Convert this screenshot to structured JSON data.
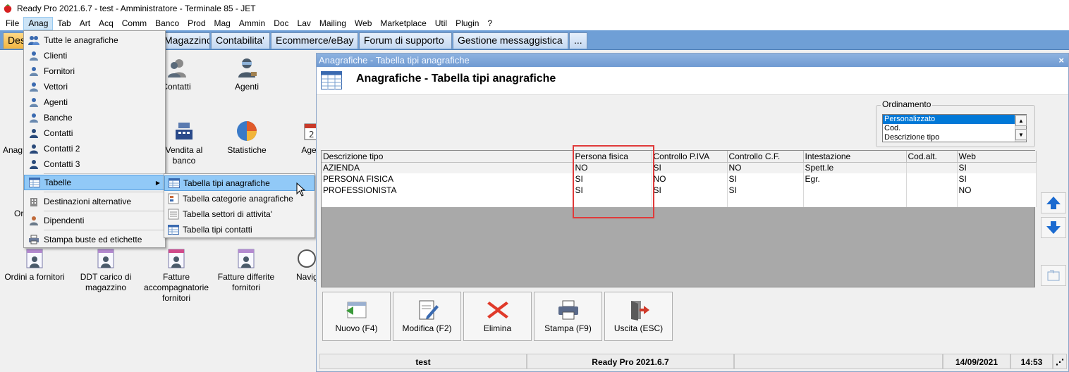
{
  "window": {
    "title": "Ready Pro 2021.6.7 - test - Amministratore - Terminale 85 - JET"
  },
  "menubar": [
    "File",
    "Anag",
    "Tab",
    "Art",
    "Acq",
    "Comm",
    "Banco",
    "Prod",
    "Mag",
    "Ammin",
    "Doc",
    "Lav",
    "Mailing",
    "Web",
    "Marketplace",
    "Util",
    "Plugin",
    "?"
  ],
  "tabs": [
    "Desk",
    "Magazzino",
    "Contabilita'",
    "Ecommerce/eBay",
    "Forum di supporto",
    "Gestione messaggistica",
    "..."
  ],
  "desktop": {
    "icons": {
      "contatti": "Contatti",
      "agenti": "Agenti",
      "vendita_banco": "Vendita al banco",
      "statistiche": "Statistiche",
      "agenda": "Age",
      "anag": "Anag",
      "or": "Or",
      "ordini_fornitori": "Ordini a fornitori",
      "ddt_carico": "DDT carico di magazzino",
      "fatture_acc": "Fatture accompagnatorie fornitori",
      "fatture_diff": "Fatture differite fornitori",
      "navig": "Navig"
    }
  },
  "anag_menu": {
    "items": [
      "Tutte le anagrafiche",
      "Clienti",
      "Fornitori",
      "Vettori",
      "Agenti",
      "Banche",
      "Contatti",
      "Contatti 2",
      "Contatti 3"
    ],
    "tabelle": "Tabelle",
    "destinazioni": "Destinazioni alternative",
    "dipendenti": "Dipendenti",
    "stampa_buste": "Stampa buste ed etichette"
  },
  "tabelle_submenu": [
    "Tabella tipi anagrafiche",
    "Tabella categorie anagrafiche",
    "Tabella settori di attivita'",
    "Tabella tipi contatti"
  ],
  "child_window": {
    "titlebar": "Anagrafiche - Tabella tipi anagrafiche",
    "close": "×",
    "header_title": "Anagrafiche - Tabella tipi anagrafiche",
    "ordinamento": {
      "label": "Ordinamento",
      "options": [
        "Personalizzato",
        "Cod.",
        "Descrizione tipo"
      ],
      "selected": "Personalizzato"
    },
    "grid": {
      "columns": [
        "Descrizione tipo",
        "Persona fisica",
        "Controllo P.IVA",
        "Controllo C.F.",
        "Intestazione",
        "Cod.alt.",
        "Web"
      ],
      "rows": [
        [
          "AZIENDA",
          "NO",
          "SI",
          "NO",
          "Spett.le",
          "",
          "SI"
        ],
        [
          "PERSONA FISICA",
          "SI",
          "NO",
          "SI",
          "Egr.",
          "",
          "SI"
        ],
        [
          "PROFESSIONISTA",
          "SI",
          "SI",
          "SI",
          "",
          "",
          "NO"
        ]
      ]
    },
    "buttons": {
      "nuovo": "Nuovo (F4)",
      "modifica": "Modifica (F2)",
      "elimina": "Elimina",
      "stampa": "Stampa (F9)",
      "uscita": "Uscita (ESC)"
    },
    "status": {
      "user": "test",
      "version": "Ready Pro 2021.6.7",
      "date": "14/09/2021",
      "time": "14:53"
    }
  },
  "colors": {
    "accent": "#0078d7",
    "tabstrip": "#6f9fd6",
    "highlight_box": "#e03a3a"
  }
}
